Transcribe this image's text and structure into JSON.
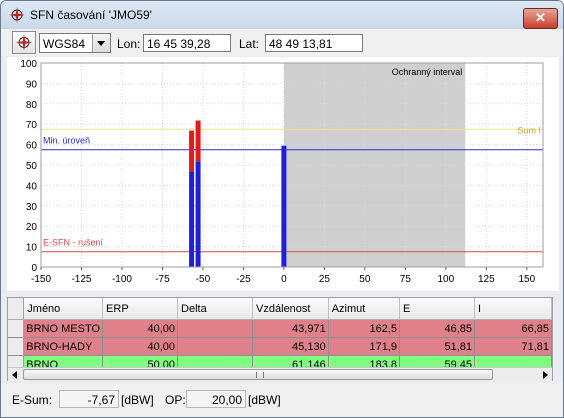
{
  "window": {
    "title": "SFN časování 'JMO59'",
    "close_glyph": "✕"
  },
  "toolbar": {
    "icon": "compass-star-icon",
    "datum_value": "WGS84",
    "lon_label": "Lon:",
    "lon_value": "16 45 39,28",
    "lat_label": "Lat:",
    "lat_value": "48 49 13,81"
  },
  "chart_data": {
    "type": "bar",
    "xlim": [
      -150,
      160
    ],
    "ylim": [
      0,
      100
    ],
    "xticks": [
      "-150",
      "-125",
      "-100",
      "-75",
      "-50",
      "-25",
      "0",
      "25",
      "50",
      "75",
      "100",
      "125",
      "150"
    ],
    "yticks": [
      "0",
      "10",
      "20",
      "30",
      "40",
      "50",
      "60",
      "70",
      "80",
      "90",
      "100"
    ],
    "guard_interval": {
      "label": "Ochranný interval",
      "from": 0,
      "to": 112
    },
    "lines": [
      {
        "label": "Sum I",
        "y": 67.5,
        "color": "#f3e08a"
      },
      {
        "label": "Min. úroveň",
        "y": 57.5,
        "color": "#2b2bd0"
      },
      {
        "label": "E-SFN - rušení",
        "y": 7.5,
        "color": "#d84a4a"
      }
    ],
    "bars": [
      {
        "x": -57,
        "blue": 46.85,
        "red": 66.85
      },
      {
        "x": -53,
        "blue": 51.81,
        "red": 71.81
      },
      {
        "x": 0,
        "blue": 59.45,
        "red": 59.45
      }
    ],
    "grid": true,
    "colors": {
      "blue": "#1f1fd8",
      "red": "#e21a1a",
      "guard": "#cfcfcf"
    }
  },
  "table": {
    "columns": [
      "Jméno",
      "ERP",
      "Delta",
      "Vzdálenost",
      "Azimut",
      "E",
      "I"
    ],
    "rows": [
      {
        "cells": [
          "BRNO MESTO",
          "40,00",
          "",
          "43,971",
          "162,5",
          "46,85",
          "66,85"
        ],
        "color": "#e0808a"
      },
      {
        "cells": [
          "BRNO-HADY",
          "40,00",
          "",
          "45,130",
          "171,9",
          "51,81",
          "71,81"
        ],
        "color": "#e0808a"
      },
      {
        "cells": [
          "BRNO",
          "50,00",
          "",
          "61,146",
          "183,8",
          "59,45",
          ""
        ],
        "color": "#80ff80"
      }
    ]
  },
  "status": {
    "esum_label": "E-Sum:",
    "esum_value": "-7,67",
    "unit1": "[dBW]",
    "op_label": "OP:",
    "op_value": "20,00",
    "unit2": "[dBW]"
  }
}
